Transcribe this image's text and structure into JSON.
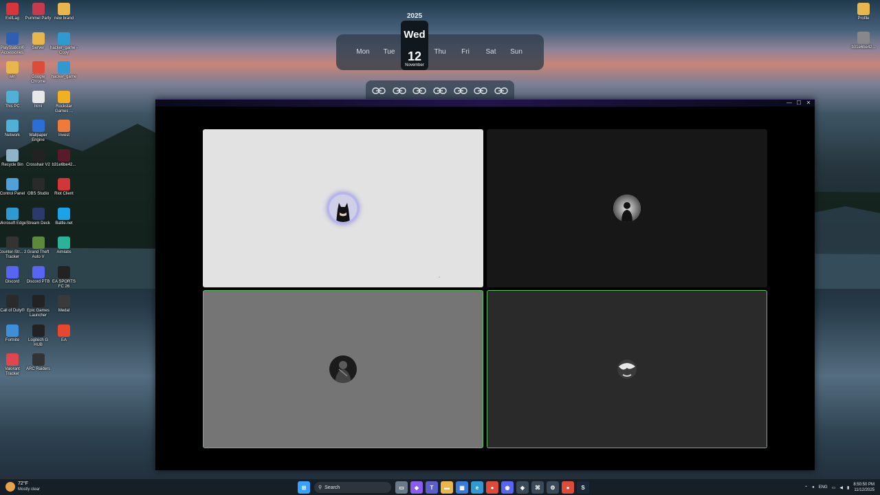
{
  "desktop": {
    "left_icons": [
      {
        "label": "ExitLag",
        "icon": "exitlag-icon",
        "color": "#d9343b"
      },
      {
        "label": "Pummel Party",
        "icon": "pummel-party-icon",
        "color": "#c53a4c"
      },
      {
        "label": "new brand",
        "icon": "folder-icon",
        "color": "#e8b64a"
      },
      {
        "label": "PlayStation® Accessories",
        "icon": "playstation-icon",
        "color": "#2f5fb3"
      },
      {
        "label": "Server",
        "icon": "folder-icon",
        "color": "#e8b64a"
      },
      {
        "label": "hacker_game - Copy",
        "icon": "edge-icon",
        "color": "#2f9ad1"
      },
      {
        "label": "win",
        "icon": "folder-icon",
        "color": "#e8b64a"
      },
      {
        "label": "Google Chrome",
        "icon": "chrome-icon",
        "color": "#dd4b39"
      },
      {
        "label": "hacker_game",
        "icon": "edge-icon",
        "color": "#2f9ad1"
      },
      {
        "label": "This PC",
        "icon": "monitor-icon",
        "color": "#4fb0d8"
      },
      {
        "label": "html",
        "icon": "file-icon",
        "color": "#e8e8e8"
      },
      {
        "label": "Rockstar Games ...",
        "icon": "rockstar-icon",
        "color": "#f2b01e"
      },
      {
        "label": "Network",
        "icon": "network-icon",
        "color": "#4fb0d8"
      },
      {
        "label": "Wallpaper Engine",
        "icon": "wallpaper-engine-icon",
        "color": "#2b6ed6"
      },
      {
        "label": "Invest",
        "icon": "invest-icon",
        "color": "#f07a3a"
      },
      {
        "label": "Recycle Bin",
        "icon": "recycle-bin-icon",
        "color": "#8fb4c8"
      },
      {
        "label": "Crosshair V2",
        "icon": "crosshair-icon",
        "color": "#222222"
      },
      {
        "label": "b31e6be42...",
        "icon": "image-icon",
        "color": "#5a1a2a"
      },
      {
        "label": "Control Panel",
        "icon": "control-panel-icon",
        "color": "#4fa2d8"
      },
      {
        "label": "OBS Studio",
        "icon": "obs-icon",
        "color": "#2a2a2a"
      },
      {
        "label": "Riot Client",
        "icon": "riot-icon",
        "color": "#d13639"
      },
      {
        "label": "Microsoft Edge",
        "icon": "edge-icon",
        "color": "#2f9ad1"
      },
      {
        "label": "Stream Deck",
        "icon": "stream-deck-icon",
        "color": "#2b3a6b"
      },
      {
        "label": "Battle.net",
        "icon": "battlenet-icon",
        "color": "#1aa3e8"
      },
      {
        "label": "Counter-Str... 2 Tracker",
        "icon": "cs2-tracker-icon",
        "color": "#333333"
      },
      {
        "label": "Grand Theft Auto V",
        "icon": "gta-icon",
        "color": "#5c8a3a"
      },
      {
        "label": "Aimlabs",
        "icon": "aimlabs-icon",
        "color": "#2bb39a"
      },
      {
        "label": "Discord",
        "icon": "discord-icon",
        "color": "#5865f2"
      },
      {
        "label": "Discord PTB",
        "icon": "discord-icon",
        "color": "#5865f2"
      },
      {
        "label": "EA SPORTS FC 26",
        "icon": "ea-fc-icon",
        "color": "#222222"
      },
      {
        "label": "Call of Duty®",
        "icon": "cod-icon",
        "color": "#2a2a2a"
      },
      {
        "label": "Epic Games Launcher",
        "icon": "epic-icon",
        "color": "#222222"
      },
      {
        "label": "Medal",
        "icon": "medal-icon",
        "color": "#3a3a3a"
      },
      {
        "label": "Fortnite",
        "icon": "fortnite-icon",
        "color": "#3f8fd8"
      },
      {
        "label": "Logitech G HUB",
        "icon": "logitech-icon",
        "color": "#222222"
      },
      {
        "label": "EA",
        "icon": "ea-icon",
        "color": "#e6472e"
      },
      {
        "label": "Valorant Tracker",
        "icon": "valorant-tracker-icon",
        "color": "#e0464d"
      },
      {
        "label": "ARC Raiders",
        "icon": "arc-raiders-icon",
        "color": "#333333"
      }
    ],
    "right_icons": [
      {
        "label": "Profile",
        "icon": "folder-icon",
        "color": "#e8b64a"
      },
      {
        "label": "b31e6be42...",
        "icon": "image-icon",
        "color": "#888888"
      }
    ]
  },
  "calendar": {
    "year": "2025",
    "days": [
      "Mon",
      "Tue",
      "Thu",
      "Fri",
      "Sat",
      "Sun"
    ],
    "today": {
      "dow": "Wed",
      "day": "12",
      "month": "November"
    }
  },
  "link_dock": {
    "count": 7,
    "icon": "link-icon"
  },
  "app": {
    "controls": {
      "minimize": "—",
      "maximize": "☐",
      "close": "✕"
    },
    "participants": [
      {
        "name": "participant-1",
        "avatar": "batman-avatar-icon",
        "speaking": true,
        "bg": "#e2e2e2"
      },
      {
        "name": "participant-2",
        "avatar": "silhouette-avatar-icon",
        "speaking": false,
        "bg": "#171717"
      },
      {
        "name": "participant-3",
        "avatar": "dark-figure-avatar-icon",
        "speaking": false,
        "bg": "#757575"
      },
      {
        "name": "participant-4",
        "avatar": "globe-avatar-icon",
        "speaking": false,
        "bg": "#2a2a2a"
      }
    ],
    "accent_border": "#58c35a",
    "speaking_ring": "#b8b6f6"
  },
  "taskbar": {
    "weather": {
      "temp": "72°F",
      "condition": "Mostly clear"
    },
    "search_label": "Search",
    "apps": [
      {
        "icon": "windows-start-icon",
        "color": "#3aa0ff",
        "glyph": "⊞"
      },
      {
        "icon": "task-view-icon",
        "color": "#6a7a88",
        "glyph": "▭"
      },
      {
        "icon": "copilot-icon",
        "color": "#8a5cf0",
        "glyph": "◆"
      },
      {
        "icon": "teams-icon",
        "color": "#5b5fc7",
        "glyph": "T"
      },
      {
        "icon": "file-explorer-icon",
        "color": "#e8b64a",
        "glyph": "▬"
      },
      {
        "icon": "store-icon",
        "color": "#3b7bd8",
        "glyph": "▦"
      },
      {
        "icon": "edge-icon",
        "color": "#2f9ad1",
        "glyph": "e"
      },
      {
        "icon": "chrome-icon",
        "color": "#dd4b39",
        "glyph": "●"
      },
      {
        "icon": "discord-icon",
        "color": "#5865f2",
        "glyph": "◉"
      },
      {
        "icon": "app-icon",
        "color": "#3a4a58",
        "glyph": "◈"
      },
      {
        "icon": "gamepad-icon",
        "color": "#3a4a58",
        "glyph": "⌘"
      },
      {
        "icon": "settings-icon",
        "color": "#3a4a58",
        "glyph": "⚙"
      },
      {
        "icon": "chrome-icon",
        "color": "#dd4b39",
        "glyph": "●"
      },
      {
        "icon": "steam-icon",
        "color": "#1b2838",
        "glyph": "S"
      }
    ],
    "tray": {
      "lang": "ENG",
      "time": "8:50:50 PM",
      "date": "11/12/2025"
    }
  }
}
